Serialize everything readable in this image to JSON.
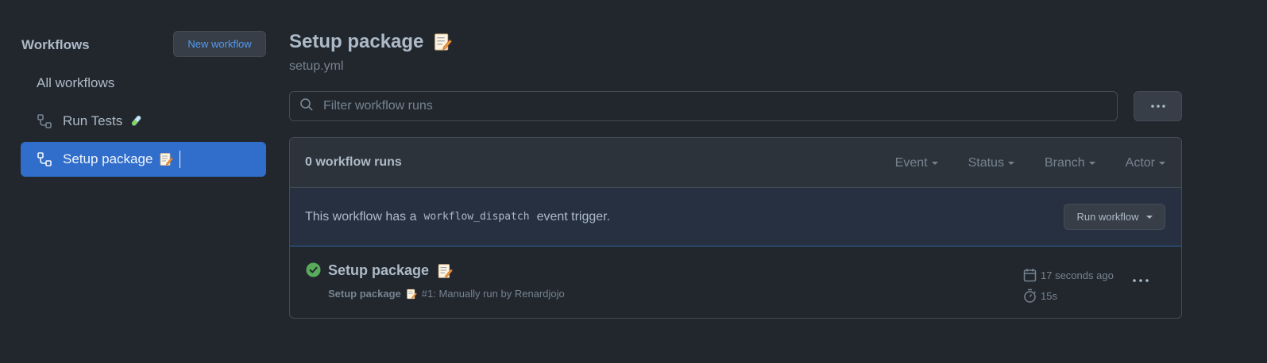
{
  "sidebar": {
    "title": "Workflows",
    "new_workflow_label": "New workflow",
    "items": [
      {
        "label": "All workflows"
      },
      {
        "label": "Run Tests",
        "emoji": "🧪"
      },
      {
        "label": "Setup package",
        "emoji": "📝",
        "selected": true
      }
    ]
  },
  "workflow": {
    "title": "Setup package",
    "emoji": "📝",
    "file": "setup.yml"
  },
  "filter": {
    "placeholder": "Filter workflow runs"
  },
  "runs": {
    "count_label": "0 workflow runs",
    "filters": [
      "Event",
      "Status",
      "Branch",
      "Actor"
    ]
  },
  "dispatch": {
    "text_before": "This workflow has a",
    "code": "workflow_dispatch",
    "text_after": "event trigger.",
    "button_label": "Run workflow"
  },
  "run": {
    "title": "Setup package",
    "emoji": "📝",
    "workflow_name": "Setup package",
    "detail": "#1: Manually run by Renardjojo",
    "time_ago": "17 seconds ago",
    "duration": "15s",
    "status": "success"
  },
  "colors": {
    "background": "#22272e",
    "selected": "#316dca",
    "success": "#57ab5a",
    "link": "#539bf5"
  }
}
